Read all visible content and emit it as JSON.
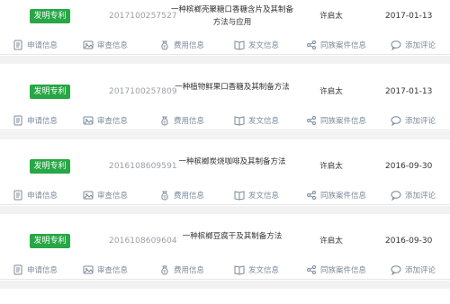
{
  "colors": {
    "badge": "#27a745",
    "muted": "#7a8a9a",
    "appno": "#9aa0a6"
  },
  "actions": {
    "apply": "申请信息",
    "review": "审查信息",
    "fee": "费用信息",
    "doc": "发文信息",
    "family": "同族案件信息",
    "comment": "添加评论"
  },
  "records": [
    {
      "type": "发明专利",
      "app_no": "2017100257527",
      "title": "一种槟榔壳聚糖口香糖含片及其制备方法与应用",
      "inventor": "许启太",
      "date": "2017-01-13"
    },
    {
      "type": "发明专利",
      "app_no": "2017100257809",
      "title": "一种植物鲜果口香糖及其制备方法",
      "inventor": "许启太",
      "date": "2017-01-13"
    },
    {
      "type": "发明专利",
      "app_no": "2016108609591",
      "title": "一种槟榔炭烧咖啡及其制备方法",
      "inventor": "许启太",
      "date": "2016-09-30"
    },
    {
      "type": "发明专利",
      "app_no": "2016108609604",
      "title": "一种槟榔豆腐干及其制备方法",
      "inventor": "许启太",
      "date": "2016-09-30"
    }
  ]
}
